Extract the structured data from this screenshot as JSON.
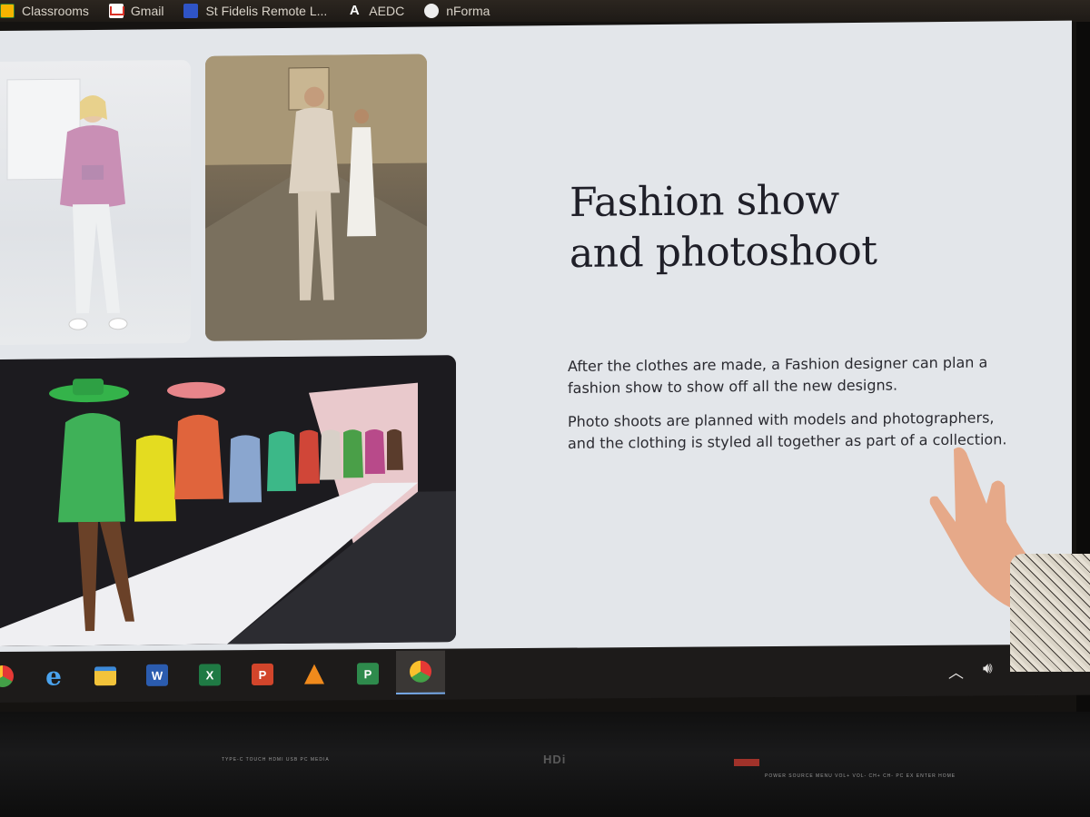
{
  "bookmarks": [
    {
      "label": "Classrooms",
      "icon": "google-classroom-icon"
    },
    {
      "label": "Gmail",
      "icon": "gmail-icon"
    },
    {
      "label": "St Fidelis Remote L...",
      "icon": "website-icon"
    },
    {
      "label": "AEDC",
      "icon": "aedc-logo-icon"
    },
    {
      "label": "nForma",
      "icon": "nforma-icon"
    }
  ],
  "slide": {
    "title_line1": "Fashion show",
    "title_line2": "and photoshoot",
    "paragraph1": "After the clothes are made, a Fashion designer can plan a fashion show to show off all the new designs.",
    "paragraph2": "Photo shoots are planned with models and photographers, and the clothing is styled all together as part of a collection."
  },
  "taskbar": {
    "apps": [
      "chrome-icon",
      "internet-explorer-icon",
      "file-explorer-icon",
      "word-icon",
      "excel-icon",
      "powerpoint-icon",
      "vlc-icon",
      "project-icon",
      "chrome-profile-icon"
    ],
    "tray": [
      "chevron-up-icon",
      "speaker-icon",
      "wifi-icon",
      "keyboard-icon"
    ]
  },
  "bezel": {
    "brand": "HDi"
  },
  "colors": {
    "slide_bg": "#e3e6ea",
    "title_text": "#1f1f28",
    "taskbar_bg": "#1d1b1a"
  }
}
